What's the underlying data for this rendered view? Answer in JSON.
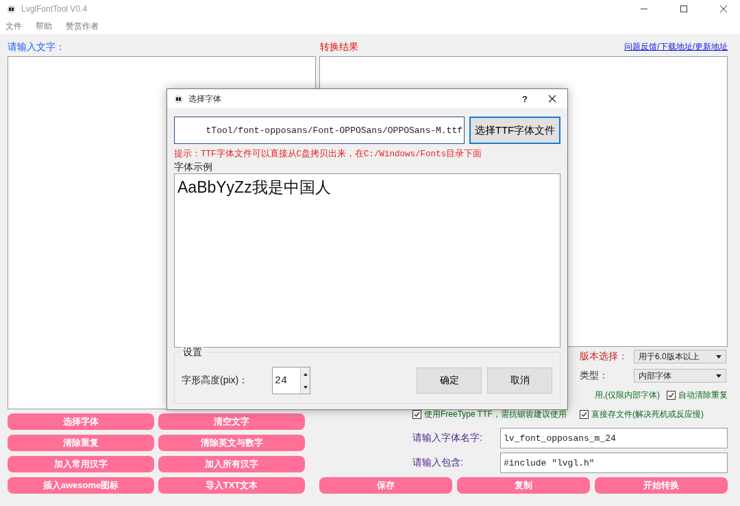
{
  "window": {
    "title": "LvglFontTool V0.4"
  },
  "menu": [
    "文件",
    "帮助",
    "赞赏作者"
  ],
  "input_panel": {
    "label": "请输入文字："
  },
  "result_panel": {
    "label": "转换结果",
    "link": "问题反馈/下载地址/更新地址"
  },
  "left_buttons": [
    "选择字体",
    "清空文字",
    "清除重复",
    "清除英文与数字",
    "加入常用汉字",
    "加入所有汉字",
    "插入awesome图标",
    "导入TXT文本"
  ],
  "version": {
    "label": "版本选择：",
    "value": "用于6.0版本以上"
  },
  "type": {
    "label": "类型：",
    "value": "内部字体"
  },
  "partial_note": "用,(仅限内部字体)",
  "checks": [
    {
      "label": "自动清除重复",
      "checked": true
    },
    {
      "label": "使用FreeType TTF，需抗锯齿建议使用",
      "checked": true
    },
    {
      "label": "直接存文件(解决死机或反应慢)",
      "checked": true
    }
  ],
  "font_name": {
    "label": "请输入字体名字:",
    "value": "lv_font_opposans_m_24"
  },
  "include": {
    "label": "请输入包含:",
    "value": "#include \"lvgl.h\""
  },
  "action_buttons": [
    "保存",
    "复制",
    "开始转换"
  ],
  "dialog": {
    "title": "选择字体",
    "help": "?",
    "path": "tTool/font-opposans/Font-OPPOSans/OPPOSans-M.ttf",
    "browse_button": "选择TTF字体文件",
    "hint": "提示：TTF字体文件可以直接从C盘拷贝出来，在C:/Windows/Fonts目录下面",
    "preview_label": "字体示例",
    "preview_text": "AaBbYyZz我是中国人",
    "group_title": "设置",
    "height_label": "字形高度(pix)：",
    "height_value": "24",
    "buttons": [
      "确定",
      "取消"
    ]
  }
}
